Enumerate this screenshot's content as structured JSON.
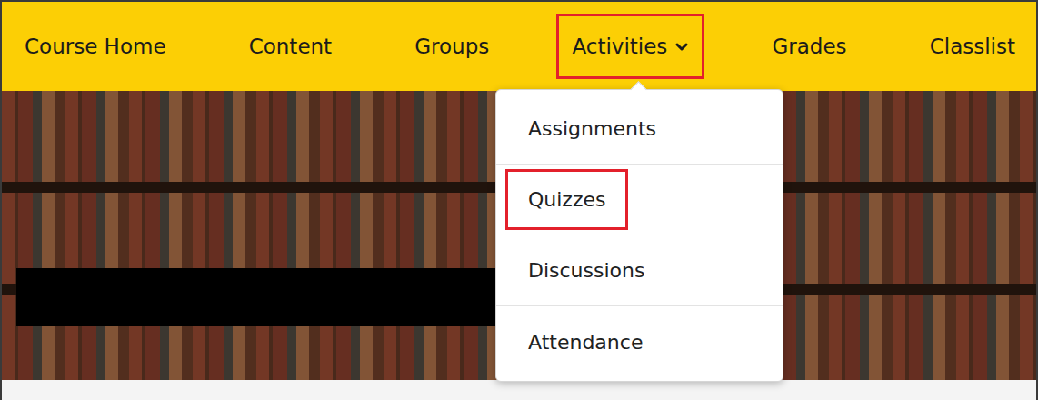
{
  "navbar": {
    "items": [
      {
        "label": "Course Home",
        "highlighted": false,
        "has_dropdown": false,
        "open": false
      },
      {
        "label": "Content",
        "highlighted": false,
        "has_dropdown": false,
        "open": false
      },
      {
        "label": "Groups",
        "highlighted": false,
        "has_dropdown": false,
        "open": false
      },
      {
        "label": "Activities",
        "highlighted": true,
        "has_dropdown": true,
        "open": true
      },
      {
        "label": "Grades",
        "highlighted": false,
        "has_dropdown": false,
        "open": false
      },
      {
        "label": "Classlist",
        "highlighted": false,
        "has_dropdown": false,
        "open": false
      }
    ]
  },
  "dropdown": {
    "items": [
      {
        "label": "Assignments",
        "highlighted": false
      },
      {
        "label": "Quizzes",
        "highlighted": true
      },
      {
        "label": "Discussions",
        "highlighted": false
      },
      {
        "label": "Attendance",
        "highlighted": false
      }
    ]
  },
  "banner": {
    "redacted": true
  }
}
